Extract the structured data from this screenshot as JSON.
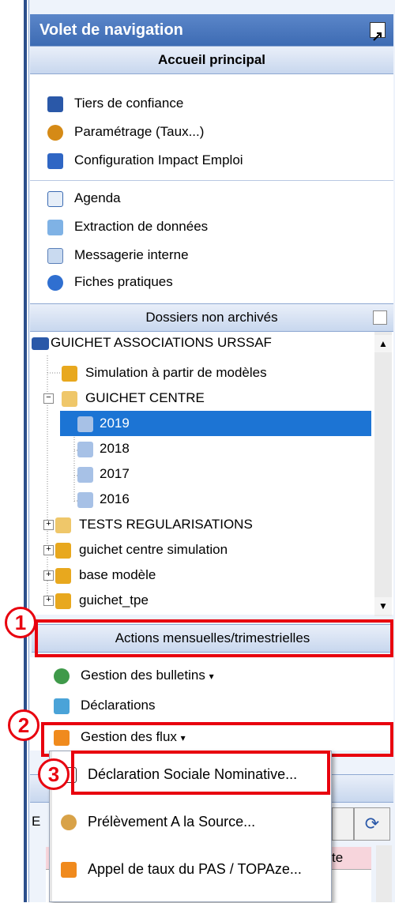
{
  "panel": {
    "title": "Volet de navigation",
    "home_header": "Accueil principal"
  },
  "home_items": [
    {
      "label": "Tiers de confiance",
      "icon": "id-card-icon"
    },
    {
      "label": "Paramétrage (Taux...)",
      "icon": "gear-icon"
    },
    {
      "label": "Configuration Impact Emploi",
      "icon": "document-edit-icon"
    },
    {
      "label": "Agenda",
      "icon": "calendar-icon"
    },
    {
      "label": "Extraction de données",
      "icon": "extract-icon"
    },
    {
      "label": "Messagerie interne",
      "icon": "mail-icon"
    },
    {
      "label": "Fiches pratiques",
      "icon": "help-icon"
    }
  ],
  "dossiers": {
    "header": "Dossiers non archivés",
    "root": "GUICHET ASSOCIATIONS URSSAF",
    "nodes": [
      "Simulation à partir de modèles",
      "GUICHET CENTRE",
      "2019",
      "2018",
      "2017",
      "2016",
      "TESTS  REGULARISATIONS",
      "guichet centre simulation",
      "base modèle",
      "guichet_tpe"
    ]
  },
  "actions": {
    "header": "Actions mensuelles/trimestrielles",
    "items": [
      {
        "label": "Gestion des bulletins",
        "arrow": "▾"
      },
      {
        "label": "Déclarations",
        "arrow": ""
      },
      {
        "label": "Gestion des flux",
        "arrow": "▾"
      }
    ]
  },
  "flux_menu": [
    "Déclaration Sociale Nominative...",
    "Prélèvement A la Source...",
    "Appel de taux du PAS / TOPAze..."
  ],
  "annotations": [
    "1",
    "2",
    "3"
  ],
  "background_fragments": {
    "left_letter": "E",
    "right_text": "te"
  },
  "colors": {
    "title_bg": "#3d6bb3",
    "selected_bg": "#1c74d4",
    "annotation_red": "#e8000e"
  }
}
